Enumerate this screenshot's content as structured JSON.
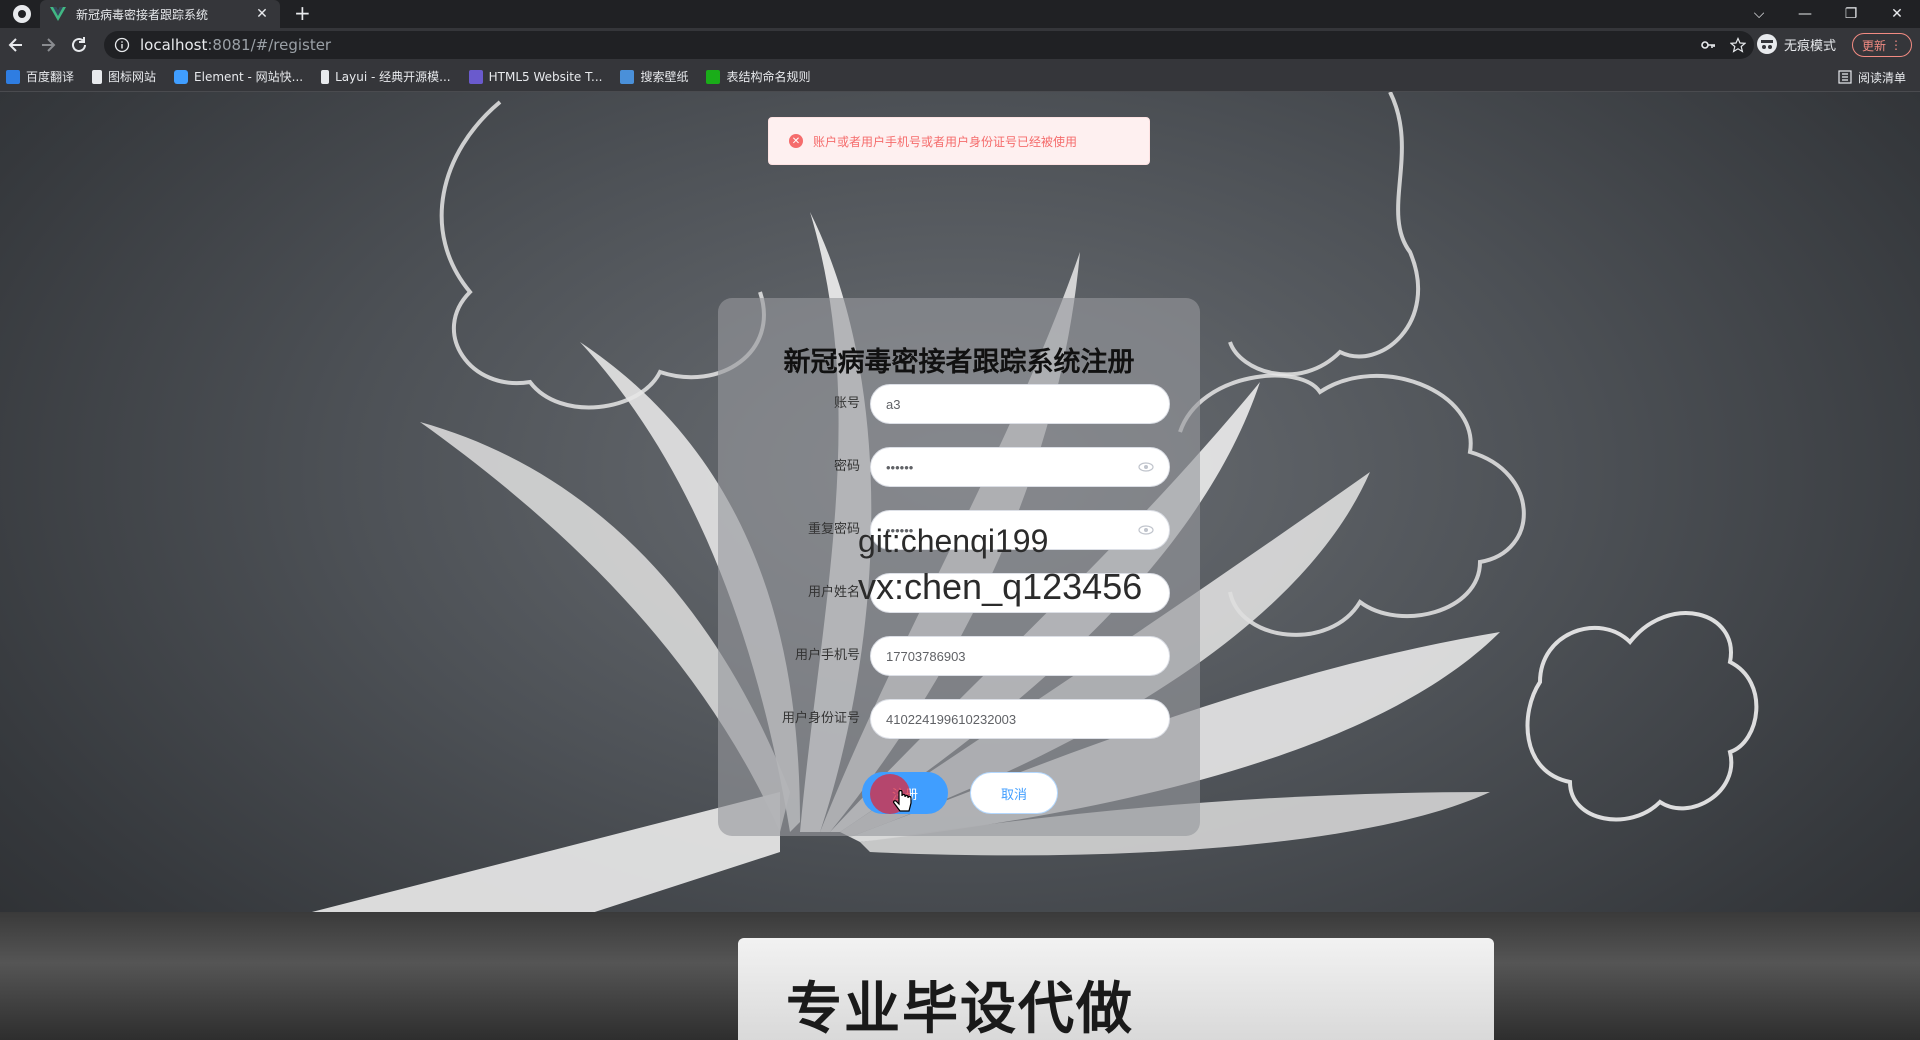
{
  "browser": {
    "tab_title": "新冠病毒密接者跟踪系统",
    "new_tab": "+",
    "url_host": "localhost",
    "url_rest": ":8081/#/register",
    "incognito_label": "无痕模式",
    "update_label": "更新",
    "window_controls": [
      "⌵",
      "—",
      "❐",
      "✕"
    ]
  },
  "bookmarks": [
    {
      "label": "百度翻译",
      "color": "#2f7de1"
    },
    {
      "label": "图标网站",
      "color": "#e8eaed"
    },
    {
      "label": "Element - 网站快...",
      "color": "#409eff"
    },
    {
      "label": "Layui - 经典开源模...",
      "color": "#e8eaed"
    },
    {
      "label": "HTML5 Website T...",
      "color": "#6a5acd"
    },
    {
      "label": "搜索壁纸",
      "color": "#4a90d9"
    },
    {
      "label": "表结构命名规则",
      "color": "#1aad19"
    }
  ],
  "reading_list_label": "阅读清单",
  "error_message": "账户或者用户手机号或者用户身份证号已经被使用",
  "form": {
    "title": "新冠病毒密接者跟踪系统注册",
    "fields": [
      {
        "label": "账号",
        "value": "a3",
        "type": "text"
      },
      {
        "label": "密码",
        "value": "••••••",
        "type": "password"
      },
      {
        "label": "重复密码",
        "value": "••••••",
        "type": "password"
      },
      {
        "label": "用户姓名",
        "value": "",
        "type": "text"
      },
      {
        "label": "用户手机号",
        "value": "17703786903",
        "type": "text"
      },
      {
        "label": "用户身份证号",
        "value": "410224199610232003",
        "type": "text"
      }
    ],
    "register_label": "注册",
    "cancel_label": "取消"
  },
  "watermark": {
    "line1": "git:chenqi199",
    "line2": "vx:chen_q123456"
  },
  "ad_text": "专业毕设代做",
  "colors": {
    "primary": "#409eff",
    "error": "#f56c6c",
    "error_bg": "#fef0f0"
  }
}
